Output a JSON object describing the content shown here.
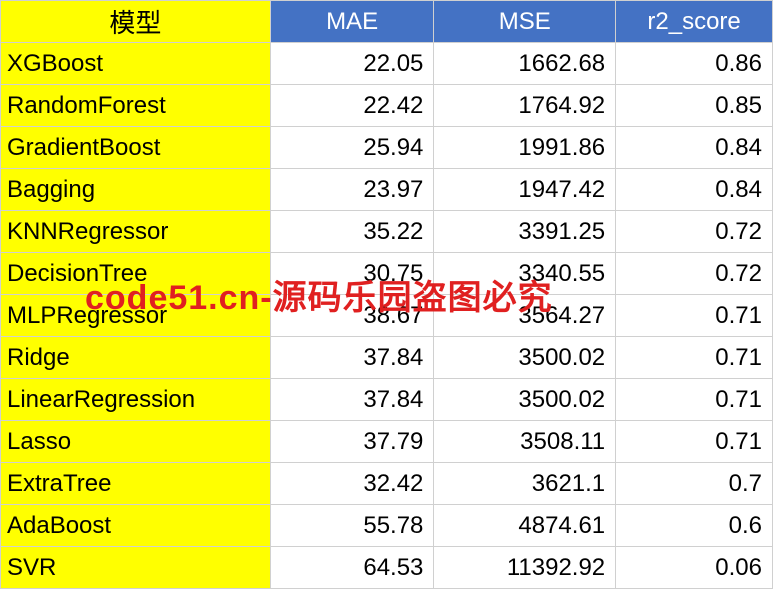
{
  "headers": {
    "model": "模型",
    "mae": "MAE",
    "mse": "MSE",
    "r2": "r2_score"
  },
  "rows": [
    {
      "model": "XGBoost",
      "mae": "22.05",
      "mse": "1662.68",
      "r2": "0.86"
    },
    {
      "model": "RandomForest",
      "mae": "22.42",
      "mse": "1764.92",
      "r2": "0.85"
    },
    {
      "model": "GradientBoost",
      "mae": "25.94",
      "mse": "1991.86",
      "r2": "0.84"
    },
    {
      "model": "Bagging",
      "mae": "23.97",
      "mse": "1947.42",
      "r2": "0.84"
    },
    {
      "model": "KNNRegressor",
      "mae": "35.22",
      "mse": "3391.25",
      "r2": "0.72"
    },
    {
      "model": "DecisionTree",
      "mae": "30.75",
      "mse": "3340.55",
      "r2": "0.72"
    },
    {
      "model": "MLPRegressor",
      "mae": "38.67",
      "mse": "3564.27",
      "r2": "0.71"
    },
    {
      "model": "Ridge",
      "mae": "37.84",
      "mse": "3500.02",
      "r2": "0.71"
    },
    {
      "model": "LinearRegression",
      "mae": "37.84",
      "mse": "3500.02",
      "r2": "0.71"
    },
    {
      "model": "Lasso",
      "mae": "37.79",
      "mse": "3508.11",
      "r2": "0.71"
    },
    {
      "model": "ExtraTree",
      "mae": "32.42",
      "mse": "3621.1",
      "r2": "0.7"
    },
    {
      "model": "AdaBoost",
      "mae": "55.78",
      "mse": "4874.61",
      "r2": "0.6"
    },
    {
      "model": "SVR",
      "mae": "64.53",
      "mse": "11392.92",
      "r2": "0.06"
    }
  ],
  "watermark_small": "code51.cn",
  "watermark_main": "code51.cn-源码乐园盗图必究",
  "chart_data": {
    "type": "table",
    "title": "模型",
    "columns": [
      "模型",
      "MAE",
      "MSE",
      "r2_score"
    ],
    "data": [
      [
        "XGBoost",
        22.05,
        1662.68,
        0.86
      ],
      [
        "RandomForest",
        22.42,
        1764.92,
        0.85
      ],
      [
        "GradientBoost",
        25.94,
        1991.86,
        0.84
      ],
      [
        "Bagging",
        23.97,
        1947.42,
        0.84
      ],
      [
        "KNNRegressor",
        35.22,
        3391.25,
        0.72
      ],
      [
        "DecisionTree",
        30.75,
        3340.55,
        0.72
      ],
      [
        "MLPRegressor",
        38.67,
        3564.27,
        0.71
      ],
      [
        "Ridge",
        37.84,
        3500.02,
        0.71
      ],
      [
        "LinearRegression",
        37.84,
        3500.02,
        0.71
      ],
      [
        "Lasso",
        37.79,
        3508.11,
        0.71
      ],
      [
        "ExtraTree",
        32.42,
        3621.1,
        0.7
      ],
      [
        "AdaBoost",
        55.78,
        4874.61,
        0.6
      ],
      [
        "SVR",
        64.53,
        11392.92,
        0.06
      ]
    ]
  }
}
